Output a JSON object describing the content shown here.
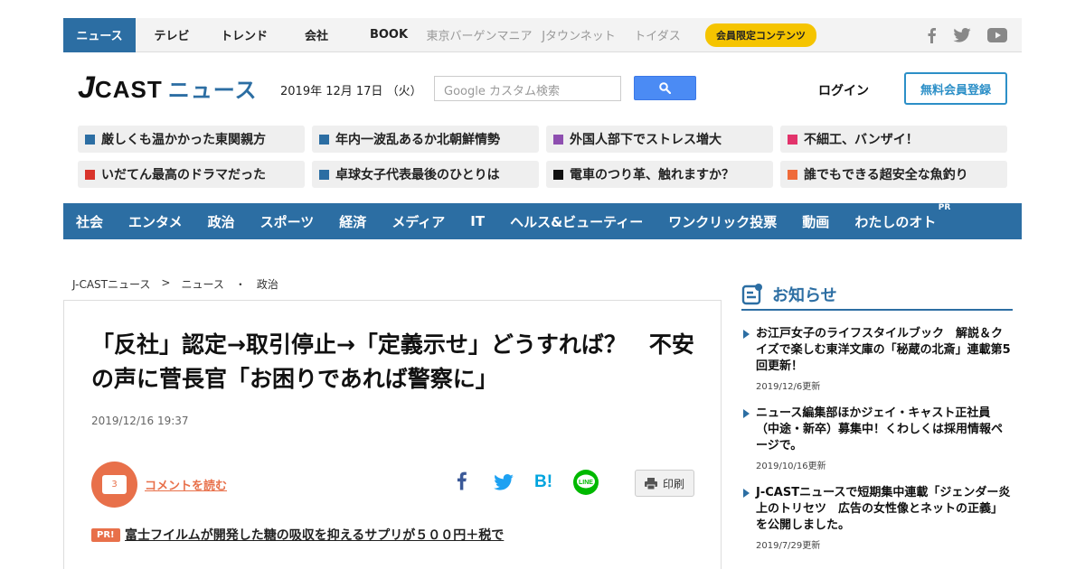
{
  "topnav": {
    "items": [
      "ニュース",
      "テレビ",
      "トレンド",
      "会社",
      "BOOK"
    ],
    "gray_items": [
      "東京バーゲンマニア",
      "Jタウンネット",
      "トイダス"
    ],
    "member_label": "会員限定コンテンツ",
    "social_icons": [
      "facebook-icon",
      "twitter-icon",
      "youtube-icon"
    ]
  },
  "header": {
    "logo_j": "J",
    "logo_cast": "CAST",
    "logo_news": "ニュース",
    "date": "2019年 12月 17日 （火）",
    "search_placeholder": "Google カスタム検索",
    "login": "ログイン",
    "register": "無料会員登録"
  },
  "topics": [
    {
      "label": "厳しくも温かかった東関親方",
      "color": "#2c6ea3"
    },
    {
      "label": "年内一波乱あるか北朝鮮情勢",
      "color": "#2c6ea3"
    },
    {
      "label": "外国人部下でストレス増大",
      "color": "#8e4fb0"
    },
    {
      "label": "不細工、バンザイ！",
      "color": "#e2336b"
    },
    {
      "label": "いだてん最高のドラマだった",
      "color": "#d9342b"
    },
    {
      "label": "卓球女子代表最後のひとりは",
      "color": "#2c6ea3"
    },
    {
      "label": "電車のつり革、触れますか？",
      "color": "#111111"
    },
    {
      "label": "誰でもできる超安全な魚釣り",
      "color": "#ef6b3a"
    }
  ],
  "categories": [
    "社会",
    "エンタメ",
    "政治",
    "スポーツ",
    "経済",
    "メディア",
    "IT",
    "ヘルス&ビューティー",
    "ワンクリック投票",
    "動画",
    "わたしのオト"
  ],
  "categories_pr": "PR",
  "breadcrumb": [
    "J-CASTニュース",
    ">",
    "ニュース",
    "・",
    "政治"
  ],
  "article": {
    "headline": "「反社」認定→取引停止→「定義示せ」どうすれば？　不安の声に菅長官「お困りであれば警察に」",
    "date": "2019/12/16 19:37",
    "comment_count": "3",
    "comment_label": "コメントを読む",
    "print_label": "印刷",
    "pr_badge": "PR!",
    "pr_text": "富士フイルムが開発した糖の吸収を抑えるサプリが５００円＋税で"
  },
  "sidebar": {
    "title": "お知らせ",
    "items": [
      {
        "text": "お江戸女子のライフスタイルブック　解説＆クイズで楽しむ東洋文庫の「秘蔵の北斎」連載第5回更新！",
        "date": "2019/12/6更新"
      },
      {
        "text": "ニュース編集部ほかジェイ・キャスト正社員（中途・新卒）募集中！くわしくは採用情報ページで。",
        "date": "2019/10/16更新"
      },
      {
        "text": "J-CASTニュースで短期集中連載「ジェンダー炎上のトリセツ　広告の女性像とネットの正義」を公開しました。",
        "date": "2019/7/29更新"
      }
    ]
  }
}
